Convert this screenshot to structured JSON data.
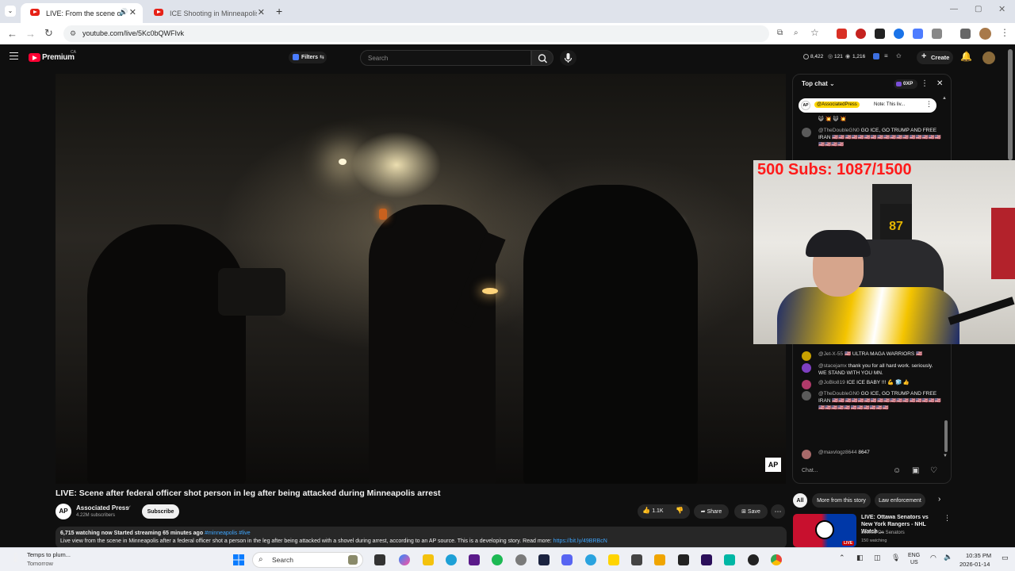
{
  "browser": {
    "tabs": [
      {
        "label": "LIVE: From the scene of a n",
        "active": true
      },
      {
        "label": "ICE Shooting in Minneapolis Li",
        "active": false
      }
    ],
    "url": "youtube.com/live/5Kc0bQWFIvk"
  },
  "youtube": {
    "brand": "Premium",
    "region": "CA",
    "filters_label": "Filters",
    "search_placeholder": "Search",
    "stats": {
      "s1": "8,422",
      "s2": "121",
      "s3": "1,216"
    },
    "create_label": "Create"
  },
  "overlay": {
    "subs_text": "500 Subs: 1087/1500"
  },
  "chat": {
    "mode_label": "Top chat",
    "xp_label": "0XP",
    "pinned": {
      "channel": "@AssociatedPress",
      "note": "Note: This liv..."
    },
    "messages": [
      {
        "author": "",
        "text": "😺 💥 😺 💥"
      },
      {
        "author": "@TheDoubleGN0",
        "text": "GO ICE, GO TRUMP AND FREE IRAN 🇺🇸🇺🇸🇺🇸🇺🇸🇺🇸🇺🇸🇺🇸🇺🇸🇺🇸🇺🇸🇺🇸🇺🇸🇺🇸🇺🇸🇺🇸🇺🇸🇺🇸🇺🇸🇺🇸🇺🇸🇺🇸"
      },
      {
        "author": "@Jet-X-55",
        "text": "🇺🇸 ULTRA MAGA WARRIORS 🇺🇸"
      },
      {
        "author": "@stacejamx",
        "text": "thank you for all hard work. seriously. WE STAND WITH YOU MN."
      },
      {
        "author": "@JoBlo819",
        "text": "ICE ICE BABY !!! 💪 🧊 👍"
      },
      {
        "author": "@TheDoubleGN0",
        "text": "GO ICE, GO TRUMP AND FREE IRAN 🇺🇸🇺🇸🇺🇸🇺🇸🇺🇸🇺🇸🇺🇸🇺🇸🇺🇸🇺🇸🇺🇸🇺🇸🇺🇸🇺🇸🇺🇸🇺🇸🇺🇸🇺🇸🇺🇸🇺🇸🇺🇸🇺🇸🇺🇸🇺🇸🇺🇸🇺🇸🇺🇸🇺🇸"
      },
      {
        "author": "@maxvlogz8644",
        "text": "8647"
      }
    ],
    "input_placeholder": "Chat..."
  },
  "video": {
    "title": "LIVE: Scene after federal officer shot person in leg after being attacked during Minneapolis arrest",
    "watermark": "AP",
    "channel": {
      "name": "Associated Press",
      "subscribers": "4.22M subscribers",
      "avatar_text": "AP"
    },
    "subscribe_label": "Subscribe",
    "likes": "1.1K",
    "share_label": "Share",
    "save_label": "Save",
    "desc_meta": "6,715 watching now  Started streaming 65 minutes ago",
    "desc_tags": "#minneapolis #live",
    "desc_text": "Live view from the scene in Minneapolis after a federal officer shot a person in the leg after being attacked with a shovel during arrest, according to an AP source. This is a developing story. Read more:",
    "desc_link": "https://bit.ly/49BRBcN"
  },
  "recommend": {
    "chips": [
      "All",
      "More from this story",
      "Law enforcement"
    ],
    "item": {
      "title": "LIVE: Ottawa Senators vs New York Rangers - NHL Watch ...",
      "channel": "Locked On Senators",
      "watching": "150 watching",
      "live_badge": "LIVE"
    }
  },
  "taskbar": {
    "weather_title": "Temps to plum...",
    "weather_sub": "Tomorrow",
    "search_label": "Search",
    "lang": "ENG",
    "lang_sub": "US",
    "time": "10:35 PM",
    "date": "2026-01-14"
  }
}
